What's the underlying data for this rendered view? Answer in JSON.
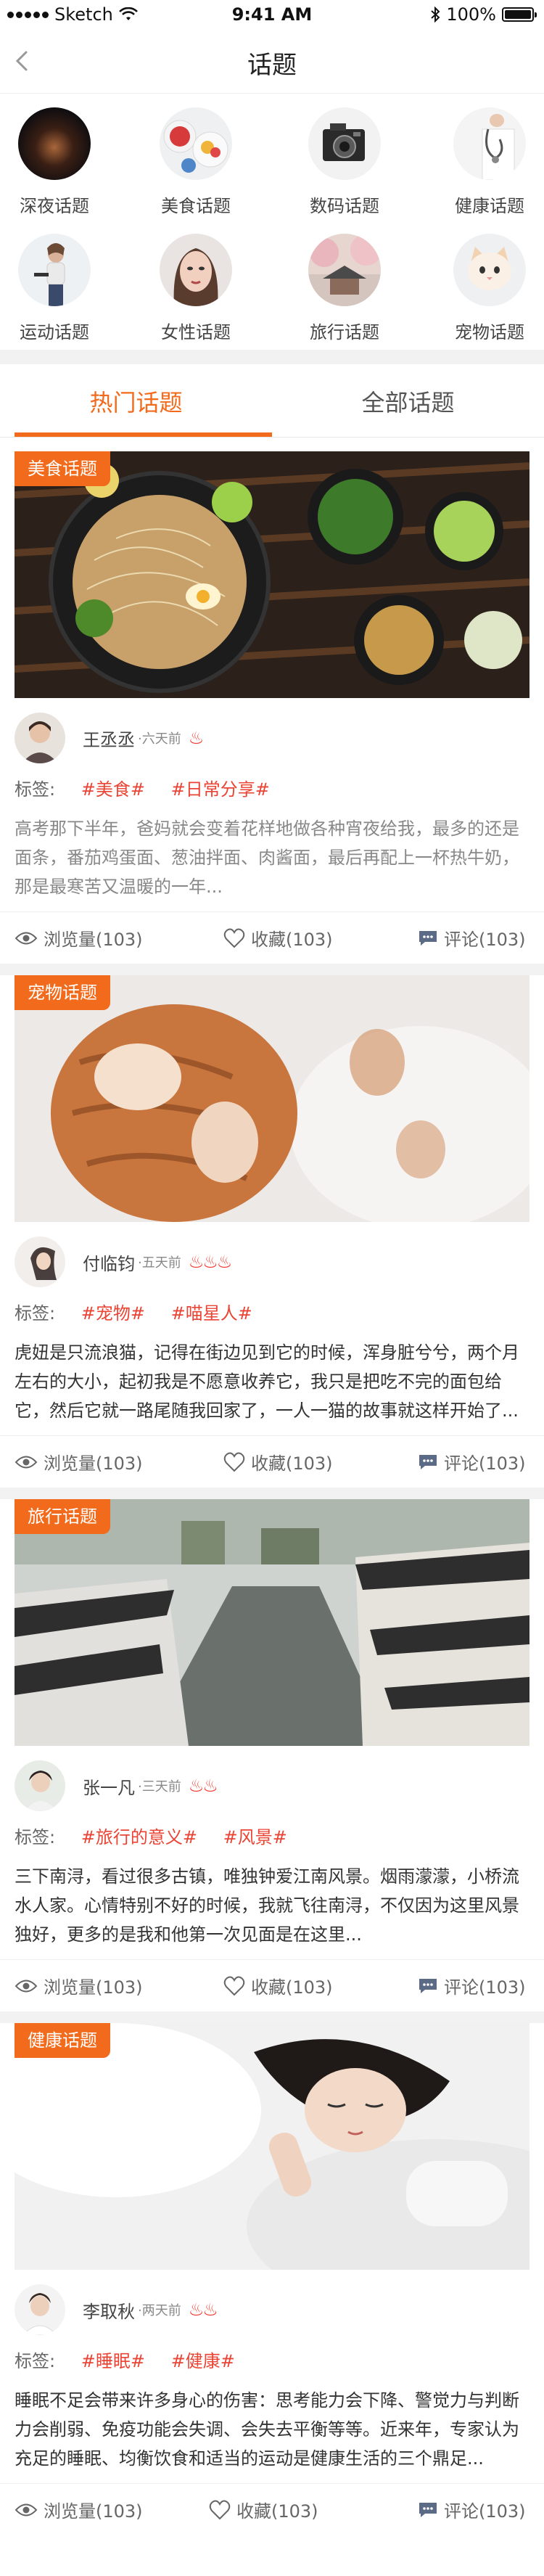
{
  "status_bar": {
    "carrier": "Sketch",
    "time": "9:41 AM",
    "battery": "100%"
  },
  "nav": {
    "title": "话题"
  },
  "categories": [
    {
      "label": "深夜话题",
      "icon": "night-photo"
    },
    {
      "label": "美食话题",
      "icon": "food-photo"
    },
    {
      "label": "数码话题",
      "icon": "camera-photo"
    },
    {
      "label": "健康话题",
      "icon": "doctor-photo"
    },
    {
      "label": "运动话题",
      "icon": "sport-photo"
    },
    {
      "label": "女性话题",
      "icon": "woman-photo"
    },
    {
      "label": "旅行话题",
      "icon": "travel-photo"
    },
    {
      "label": "宠物话题",
      "icon": "pet-photo"
    }
  ],
  "tabs": {
    "hot": "热门话题",
    "all": "全部话题"
  },
  "colors": {
    "accent": "#f26a1b",
    "tag": "#ea4435",
    "flame": "#f2352c"
  },
  "posts": [
    {
      "badge": "美食话题",
      "author": "王丞丞",
      "time": "·六天前",
      "flames": "♨",
      "tags_label": "标签:",
      "tags": [
        "#美食#",
        "#日常分享#"
      ],
      "excerpt": "高考那下半年，爸妈就会变着花样地做各种宵夜给我，最多的还是面条，番茄鸡蛋面、葱油拌面、肉酱面，最后再配上一杯热牛奶，那是最寒苦又温暖的一年...",
      "views": "浏览量(103)",
      "favorites": "收藏(103)",
      "comments": "评论(103)"
    },
    {
      "badge": "宠物话题",
      "author": "付临钧",
      "time": "·五天前",
      "flames": "♨♨♨",
      "tags_label": "标签:",
      "tags": [
        "#宠物#",
        "#喵星人#"
      ],
      "excerpt": "虎妞是只流浪猫，记得在街边见到它的时候，浑身脏兮兮，两个月左右的大小，起初我是不愿意收养它，我只是把吃不完的面包给它，然后它就一路尾随我回家了，一人一猫的故事就这样开始了...",
      "views": "浏览量(103)",
      "favorites": "收藏(103)",
      "comments": "评论(103)"
    },
    {
      "badge": "旅行话题",
      "author": "张一凡",
      "time": "·三天前",
      "flames": "♨♨",
      "tags_label": "标签:",
      "tags": [
        "#旅行的意义#",
        "#风景#"
      ],
      "excerpt": "三下南浔，看过很多古镇，唯独钟爱江南风景。烟雨濛濛，小桥流水人家。心情特别不好的时候，我就飞往南浔，不仅因为这里风景独好，更多的是我和他第一次见面是在这里...",
      "views": "浏览量(103)",
      "favorites": "收藏(103)",
      "comments": "评论(103)"
    },
    {
      "badge": "健康话题",
      "author": "李取秋",
      "time": "·两天前",
      "flames": "♨♨",
      "tags_label": "标签:",
      "tags": [
        "#睡眠#",
        "#健康#"
      ],
      "excerpt": "睡眠不足会带来许多身心的伤害：思考能力会下降、警觉力与判断力会削弱、免疫功能会失调、会失去平衡等等。近来年，专家认为充足的睡眠、均衡饮食和适当的运动是健康生活的三个鼎足...",
      "views": "浏览量(103)",
      "favorites": "收藏(103)",
      "comments": "评论(103)"
    }
  ]
}
